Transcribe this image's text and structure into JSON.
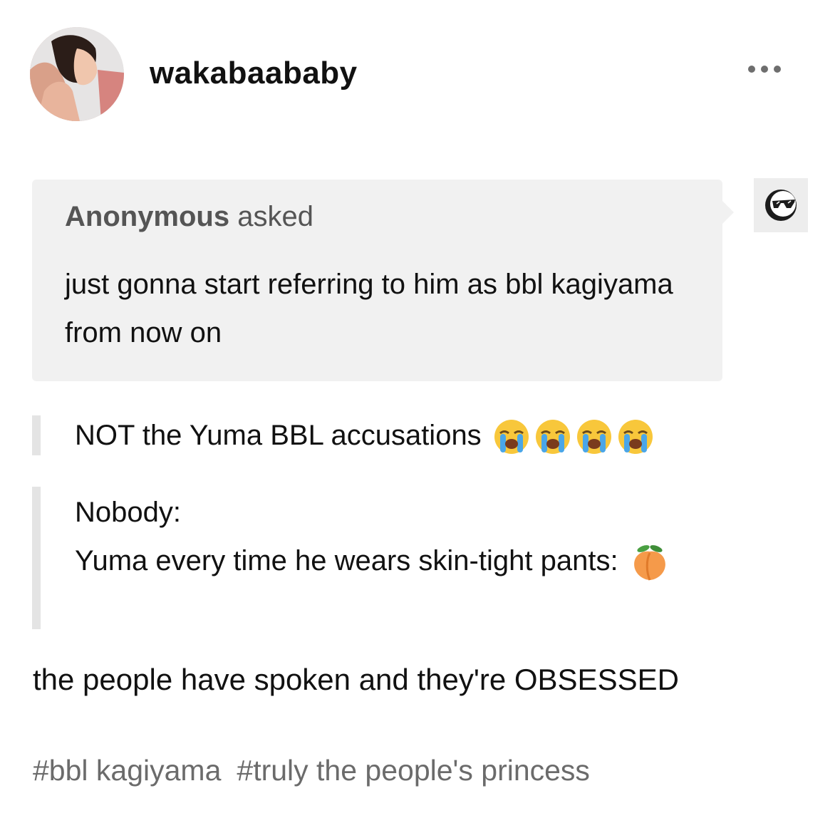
{
  "post": {
    "username": "wakabaababy",
    "more_icon": "ellipsis-icon"
  },
  "ask": {
    "asker_name": "Anonymous",
    "asker_verb": "asked",
    "question": "just gonna start referring to him as bbl kagiyama from now on",
    "anon_icon": "sunglasses-avatar-icon"
  },
  "quotes": [
    {
      "text": "NOT the Yuma BBL accusations",
      "emoji": [
        "loudly-crying-face",
        "loudly-crying-face",
        "loudly-crying-face",
        "loudly-crying-face"
      ]
    },
    {
      "line1": "Nobody:",
      "line2": "Yuma every time he wears skin-tight pants:",
      "emoji": [
        "peach"
      ]
    }
  ],
  "body": "the people have spoken and they're OBSESSED",
  "tags": [
    "#bbl kagiyama",
    "#truly the people's princess"
  ],
  "colors": {
    "ask_background": "#f1f1f1",
    "quote_bar": "#e4e4e4",
    "tag_text": "#6b6b6b"
  }
}
